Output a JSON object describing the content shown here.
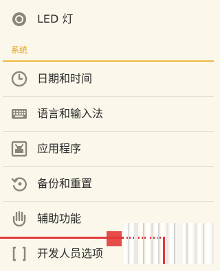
{
  "top_item": {
    "label": "LED 灯",
    "icon": "led-icon"
  },
  "section": {
    "title": "系统"
  },
  "items": [
    {
      "label": "日期和时间",
      "icon": "clock-icon"
    },
    {
      "label": "语言和输入法",
      "icon": "keyboard-icon"
    },
    {
      "label": "应用程序",
      "icon": "apps-icon"
    },
    {
      "label": "备份和重置",
      "icon": "backup-icon"
    },
    {
      "label": "辅助功能",
      "icon": "hand-icon"
    },
    {
      "label": "开发人员选项",
      "icon": "developer-icon"
    }
  ],
  "colors": {
    "background": "#fbf7ea",
    "accent": "#efb83c",
    "section_text": "#e0a21e",
    "icon": "#8a857a",
    "text": "#2e2e2e",
    "highlight_red": "#e23a3a"
  }
}
